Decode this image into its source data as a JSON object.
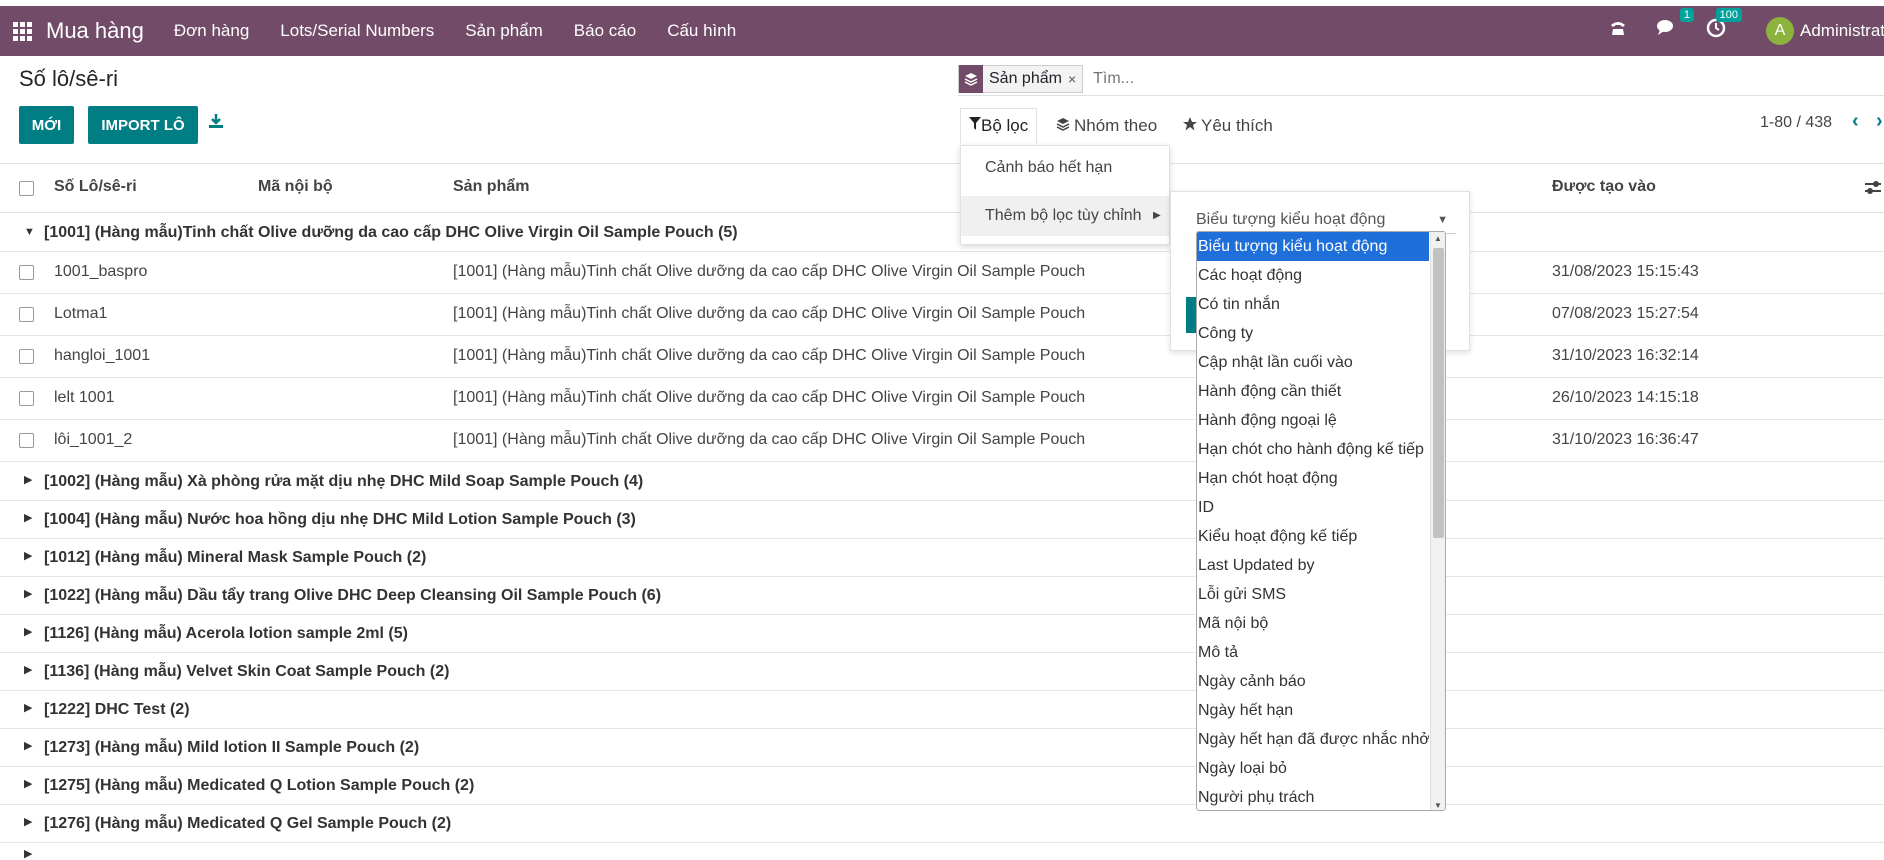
{
  "nav": {
    "brand": "Mua hàng",
    "menus": [
      "Đơn hàng",
      "Lots/Serial Numbers",
      "Sản phẩm",
      "Báo cáo",
      "Cấu hình"
    ],
    "chat_badge": "1",
    "activity_badge": "100",
    "avatar_initial": "A",
    "user": "Administrator"
  },
  "page": {
    "title": "Số lô/sê-ri",
    "new_button": "MỚI",
    "import_button": "IMPORT LÔ"
  },
  "search": {
    "facet_label": "Sản phẩm",
    "facet_close": "×",
    "placeholder": "Tìm..."
  },
  "tabs": {
    "filters": "Bộ lọc",
    "group_by": "Nhóm theo",
    "favorites": "Yêu thích"
  },
  "pager": {
    "value": "1-80 / 438"
  },
  "columns": {
    "lot": "Số Lô/sê-ri",
    "ref": "Mã nội bộ",
    "product": "Sản phẩm",
    "created": "Được tạo vào"
  },
  "groups": [
    {
      "label": "[1001] (Hàng mẫu)Tinh chất Olive dưỡng da cao cấp DHC Olive Virgin Oil Sample Pouch (5)",
      "expanded": true
    },
    {
      "label": "[1002] (Hàng mẫu) Xà phòng rửa mặt dịu nhẹ DHC Mild Soap Sample Pouch (4)"
    },
    {
      "label": "[1004] (Hàng mẫu) Nước hoa hồng dịu nhẹ DHC Mild Lotion Sample Pouch (3)"
    },
    {
      "label": "[1012] (Hàng mẫu) Mineral Mask Sample Pouch (2)"
    },
    {
      "label": "[1022] (Hàng mẫu) Dầu tẩy trang Olive DHC Deep Cleansing Oil Sample Pouch (6)"
    },
    {
      "label": "[1126] (Hàng mẫu) Acerola lotion sample 2ml (5)"
    },
    {
      "label": "[1136] (Hàng mẫu) Velvet Skin Coat Sample Pouch (2)"
    },
    {
      "label": "[1222] DHC Test (2)"
    },
    {
      "label": "[1273] (Hàng mẫu) Mild lotion II Sample Pouch (2)"
    },
    {
      "label": "[1275] (Hàng mẫu) Medicated Q Lotion Sample Pouch (2)"
    },
    {
      "label": "[1276] (Hàng mẫu) Medicated Q Gel Sample Pouch (2)"
    }
  ],
  "rows": [
    {
      "lot": "1001_baspro",
      "product": "[1001] (Hàng mẫu)Tinh chất Olive dưỡng da cao cấp DHC Olive Virgin Oil Sample Pouch",
      "created": "31/08/2023 15:15:43"
    },
    {
      "lot": "Lotma1",
      "product": "[1001] (Hàng mẫu)Tinh chất Olive dưỡng da cao cấp DHC Olive Virgin Oil Sample Pouch",
      "created": "07/08/2023 15:27:54"
    },
    {
      "lot": "hangloi_1001",
      "product": "[1001] (Hàng mẫu)Tinh chất Olive dưỡng da cao cấp DHC Olive Virgin Oil Sample Pouch",
      "created": "31/10/2023 16:32:14"
    },
    {
      "lot": "lelt 1001",
      "product": "[1001] (Hàng mẫu)Tinh chất Olive dưỡng da cao cấp DHC Olive Virgin Oil Sample Pouch",
      "created": "26/10/2023 14:15:18"
    },
    {
      "lot": "lôi_1001_2",
      "product": "[1001] (Hàng mẫu)Tinh chất Olive dưỡng da cao cấp DHC Olive Virgin Oil Sample Pouch",
      "created": "31/10/2023 16:36:47"
    }
  ],
  "filter_menu": {
    "item1": "Cảnh báo hết hạn",
    "item2": "Thêm bộ lọc tùy chỉnh"
  },
  "custom_filter": {
    "field_value": "Biểu tượng kiểu hoạt động",
    "options": [
      "Biểu tượng kiểu hoạt động",
      "Các hoạt động",
      "Có tin nhắn",
      "Công ty",
      "Cập nhật lần cuối vào",
      "Hành động cần thiết",
      "Hành động ngoại lệ",
      "Hạn chót cho hành động kế tiếp",
      "Hạn chót hoạt động",
      "ID",
      "Kiểu hoạt động kế tiếp",
      "Last Updated by",
      "Lỗi gửi SMS",
      "Mã nội bộ",
      "Mô tả",
      "Ngày cảnh báo",
      "Ngày hết hạn",
      "Ngày hết hạn đã được nhắc nhở",
      "Ngày loại bỏ",
      "Người phụ trách"
    ]
  },
  "icons": {
    "apps": "apps-grid-icon",
    "phone": "phone-icon",
    "chat": "chat-icon",
    "activity": "clock-icon",
    "download": "download-icon",
    "filter": "filter-icon",
    "layers": "layers-icon",
    "star": "star-icon"
  },
  "colors": {
    "navbar": "#714b67",
    "primary": "#017e84",
    "badge": "#00a09d",
    "selected_option": "#1e6fd9"
  }
}
